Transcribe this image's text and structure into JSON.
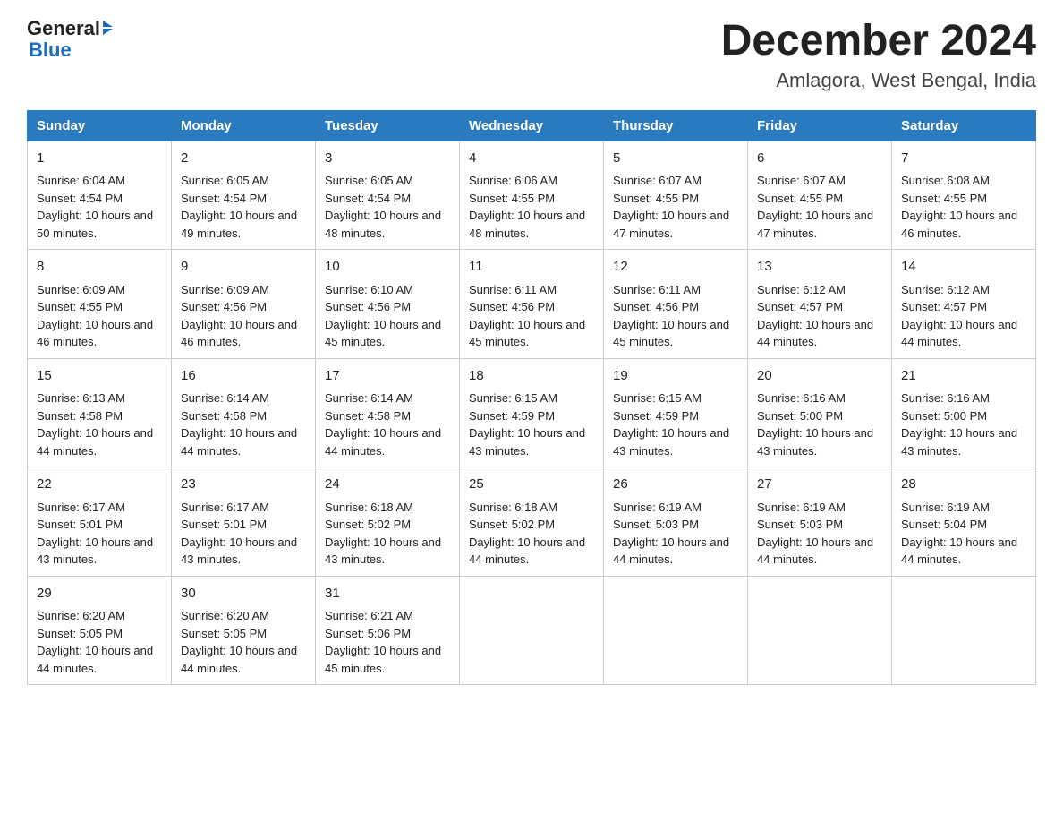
{
  "header": {
    "logo_general": "General",
    "logo_blue": "Blue",
    "month_title": "December 2024",
    "location": "Amlagora, West Bengal, India"
  },
  "days_of_week": [
    "Sunday",
    "Monday",
    "Tuesday",
    "Wednesday",
    "Thursday",
    "Friday",
    "Saturday"
  ],
  "weeks": [
    [
      {
        "day": "1",
        "sunrise": "6:04 AM",
        "sunset": "4:54 PM",
        "daylight": "10 hours and 50 minutes."
      },
      {
        "day": "2",
        "sunrise": "6:05 AM",
        "sunset": "4:54 PM",
        "daylight": "10 hours and 49 minutes."
      },
      {
        "day": "3",
        "sunrise": "6:05 AM",
        "sunset": "4:54 PM",
        "daylight": "10 hours and 48 minutes."
      },
      {
        "day": "4",
        "sunrise": "6:06 AM",
        "sunset": "4:55 PM",
        "daylight": "10 hours and 48 minutes."
      },
      {
        "day": "5",
        "sunrise": "6:07 AM",
        "sunset": "4:55 PM",
        "daylight": "10 hours and 47 minutes."
      },
      {
        "day": "6",
        "sunrise": "6:07 AM",
        "sunset": "4:55 PM",
        "daylight": "10 hours and 47 minutes."
      },
      {
        "day": "7",
        "sunrise": "6:08 AM",
        "sunset": "4:55 PM",
        "daylight": "10 hours and 46 minutes."
      }
    ],
    [
      {
        "day": "8",
        "sunrise": "6:09 AM",
        "sunset": "4:55 PM",
        "daylight": "10 hours and 46 minutes."
      },
      {
        "day": "9",
        "sunrise": "6:09 AM",
        "sunset": "4:56 PM",
        "daylight": "10 hours and 46 minutes."
      },
      {
        "day": "10",
        "sunrise": "6:10 AM",
        "sunset": "4:56 PM",
        "daylight": "10 hours and 45 minutes."
      },
      {
        "day": "11",
        "sunrise": "6:11 AM",
        "sunset": "4:56 PM",
        "daylight": "10 hours and 45 minutes."
      },
      {
        "day": "12",
        "sunrise": "6:11 AM",
        "sunset": "4:56 PM",
        "daylight": "10 hours and 45 minutes."
      },
      {
        "day": "13",
        "sunrise": "6:12 AM",
        "sunset": "4:57 PM",
        "daylight": "10 hours and 44 minutes."
      },
      {
        "day": "14",
        "sunrise": "6:12 AM",
        "sunset": "4:57 PM",
        "daylight": "10 hours and 44 minutes."
      }
    ],
    [
      {
        "day": "15",
        "sunrise": "6:13 AM",
        "sunset": "4:58 PM",
        "daylight": "10 hours and 44 minutes."
      },
      {
        "day": "16",
        "sunrise": "6:14 AM",
        "sunset": "4:58 PM",
        "daylight": "10 hours and 44 minutes."
      },
      {
        "day": "17",
        "sunrise": "6:14 AM",
        "sunset": "4:58 PM",
        "daylight": "10 hours and 44 minutes."
      },
      {
        "day": "18",
        "sunrise": "6:15 AM",
        "sunset": "4:59 PM",
        "daylight": "10 hours and 43 minutes."
      },
      {
        "day": "19",
        "sunrise": "6:15 AM",
        "sunset": "4:59 PM",
        "daylight": "10 hours and 43 minutes."
      },
      {
        "day": "20",
        "sunrise": "6:16 AM",
        "sunset": "5:00 PM",
        "daylight": "10 hours and 43 minutes."
      },
      {
        "day": "21",
        "sunrise": "6:16 AM",
        "sunset": "5:00 PM",
        "daylight": "10 hours and 43 minutes."
      }
    ],
    [
      {
        "day": "22",
        "sunrise": "6:17 AM",
        "sunset": "5:01 PM",
        "daylight": "10 hours and 43 minutes."
      },
      {
        "day": "23",
        "sunrise": "6:17 AM",
        "sunset": "5:01 PM",
        "daylight": "10 hours and 43 minutes."
      },
      {
        "day": "24",
        "sunrise": "6:18 AM",
        "sunset": "5:02 PM",
        "daylight": "10 hours and 43 minutes."
      },
      {
        "day": "25",
        "sunrise": "6:18 AM",
        "sunset": "5:02 PM",
        "daylight": "10 hours and 44 minutes."
      },
      {
        "day": "26",
        "sunrise": "6:19 AM",
        "sunset": "5:03 PM",
        "daylight": "10 hours and 44 minutes."
      },
      {
        "day": "27",
        "sunrise": "6:19 AM",
        "sunset": "5:03 PM",
        "daylight": "10 hours and 44 minutes."
      },
      {
        "day": "28",
        "sunrise": "6:19 AM",
        "sunset": "5:04 PM",
        "daylight": "10 hours and 44 minutes."
      }
    ],
    [
      {
        "day": "29",
        "sunrise": "6:20 AM",
        "sunset": "5:05 PM",
        "daylight": "10 hours and 44 minutes."
      },
      {
        "day": "30",
        "sunrise": "6:20 AM",
        "sunset": "5:05 PM",
        "daylight": "10 hours and 44 minutes."
      },
      {
        "day": "31",
        "sunrise": "6:21 AM",
        "sunset": "5:06 PM",
        "daylight": "10 hours and 45 minutes."
      },
      null,
      null,
      null,
      null
    ]
  ],
  "labels": {
    "sunrise": "Sunrise:",
    "sunset": "Sunset:",
    "daylight": "Daylight:"
  }
}
